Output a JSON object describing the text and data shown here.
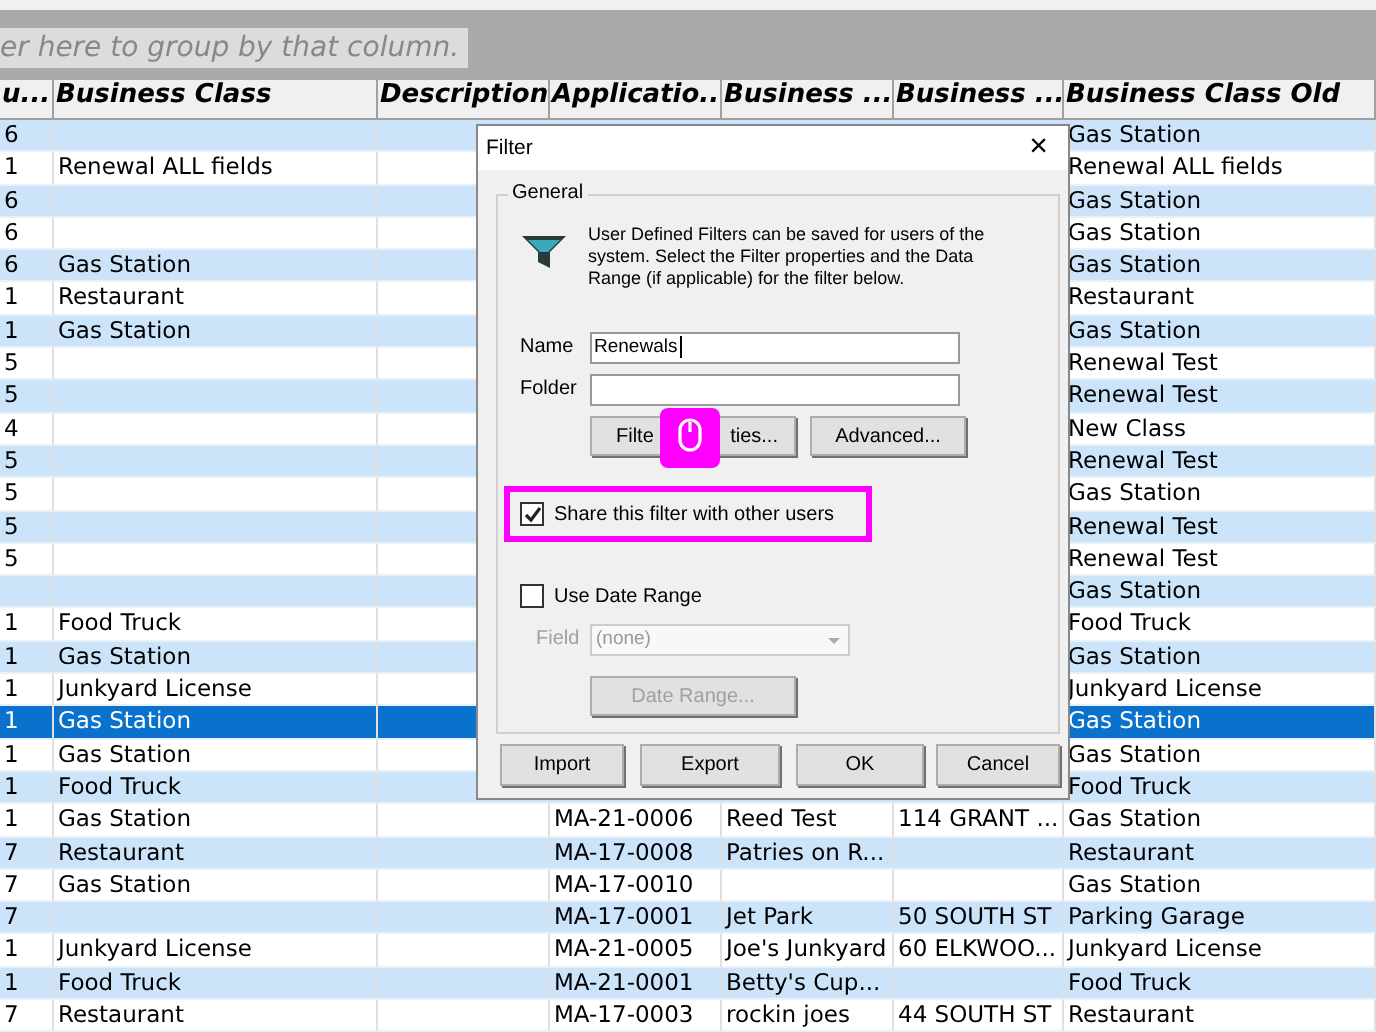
{
  "group_panel": {
    "text": "er here to group by that column."
  },
  "table": {
    "columns": [
      "u...",
      "Business Class",
      "Description",
      "Applicatio...",
      "Business ...",
      "Business ...",
      "Business Class Old"
    ],
    "rows": [
      {
        "col_1": "6",
        "business_class": "",
        "business_class_old": "Gas Station",
        "selected": false
      },
      {
        "col_1": "1",
        "business_class": "Renewal ALL fields",
        "business_class_old": "Renewal ALL fields",
        "selected": false
      },
      {
        "col_1": "6",
        "business_class": "",
        "business_class_old": "Gas Station",
        "selected": false
      },
      {
        "col_1": "6",
        "business_class": "",
        "business_class_old": "Gas Station",
        "selected": false
      },
      {
        "col_1": "6",
        "business_class": "Gas Station",
        "business_class_old": "Gas Station",
        "selected": false
      },
      {
        "col_1": "1",
        "business_class": "Restaurant",
        "business_class_old": "Restaurant",
        "selected": false
      },
      {
        "col_1": "1",
        "business_class": "Gas Station",
        "business_class_old": "Gas Station",
        "selected": false
      },
      {
        "col_1": "5",
        "business_class": "",
        "business_class_old": "Renewal Test",
        "selected": false
      },
      {
        "col_1": "5",
        "business_class": "",
        "business_class_old": "Renewal Test",
        "selected": false
      },
      {
        "col_1": "4",
        "business_class": "",
        "business_class_old": "New Class",
        "selected": false
      },
      {
        "col_1": "5",
        "business_class": "",
        "business_class_old": "Renewal Test",
        "selected": false
      },
      {
        "col_1": "5",
        "business_class": "",
        "business_class_old": "Gas Station",
        "selected": false
      },
      {
        "col_1": "5",
        "business_class": "",
        "business_class_old": "Renewal Test",
        "selected": false
      },
      {
        "col_1": "5",
        "business_class": "",
        "business_class_old": "Renewal Test",
        "selected": false
      },
      {
        "col_1": "",
        "business_class": "",
        "business_class_old": "Gas Station",
        "selected": false
      },
      {
        "col_1": "1",
        "business_class": "Food Truck",
        "business_class_old": "Food Truck",
        "selected": false
      },
      {
        "col_1": "1",
        "business_class": "Gas Station",
        "business_class_old": "Gas Station",
        "selected": false
      },
      {
        "col_1": "1",
        "business_class": "Junkyard License",
        "business_class_old": "Junkyard License",
        "selected": false
      },
      {
        "col_1": "1",
        "business_class": "Gas Station",
        "business_class_old": "Gas Station",
        "selected": true
      },
      {
        "col_1": "1",
        "business_class": "Gas Station",
        "business_class_old": "Gas Station",
        "selected": false
      },
      {
        "col_1": "1",
        "business_class": "Food Truck",
        "business_class_old": "Food Truck",
        "selected": false
      },
      {
        "col_1": "1",
        "business_class": "Gas Station",
        "application": "MA-21-0006",
        "business": "Reed Test",
        "business_2": "114 GRANT ...",
        "business_class_old": "Gas Station",
        "selected": false
      },
      {
        "col_1": "7",
        "business_class": "Restaurant",
        "application": "MA-17-0008",
        "business": "Patries on R...",
        "business_2": "",
        "business_class_old": "Restaurant",
        "selected": false
      },
      {
        "col_1": "7",
        "business_class": "Gas Station",
        "application": "MA-17-0010",
        "business": "",
        "business_2": "",
        "business_class_old": "Gas Station",
        "selected": false
      },
      {
        "col_1": "7",
        "business_class": "",
        "application": "MA-17-0001",
        "business": "Jet Park",
        "business_2": "50 SOUTH ST",
        "business_class_old": "Parking Garage",
        "selected": false
      },
      {
        "col_1": "1",
        "business_class": "Junkyard License",
        "application": "MA-21-0005",
        "business": "Joe's Junkyard",
        "business_2": "60 ELKWOO...",
        "business_class_old": "Junkyard License",
        "selected": false
      },
      {
        "col_1": "1",
        "business_class": "Food Truck",
        "application": "MA-21-0001",
        "business": "Betty's Cup...",
        "business_2": "",
        "business_class_old": "Food Truck",
        "selected": false
      },
      {
        "col_1": "7",
        "business_class": "Restaurant",
        "application": "MA-17-0003",
        "business": "rockin joes",
        "business_2": "44 SOUTH ST",
        "business_class_old": "Restaurant",
        "selected": false
      }
    ]
  },
  "dialog": {
    "title": "Filter",
    "close": "×",
    "group_title": "General",
    "description": "User Defined Filters can be saved for users of the system. Select the Filter properties and the Data Range (if applicable) for the filter below.",
    "name_label": "Name",
    "name_value": "Renewals",
    "folder_label": "Folder",
    "filter_properties_button": {
      "label_start": "Filte",
      "label_end": "ties..."
    },
    "advanced_button": "Advanced...",
    "share_checkbox": {
      "label": "Share this filter with other users",
      "checked": true,
      "highlighted": true
    },
    "date_range_checkbox": {
      "label": "Use Date Range",
      "checked": false
    },
    "field_label": "Field",
    "field_value": "(none)",
    "field_disabled": true,
    "date_range_button": {
      "label": "Date Range...",
      "disabled": true
    },
    "buttons": [
      "Import",
      "Export",
      "OK",
      "Cancel"
    ]
  }
}
